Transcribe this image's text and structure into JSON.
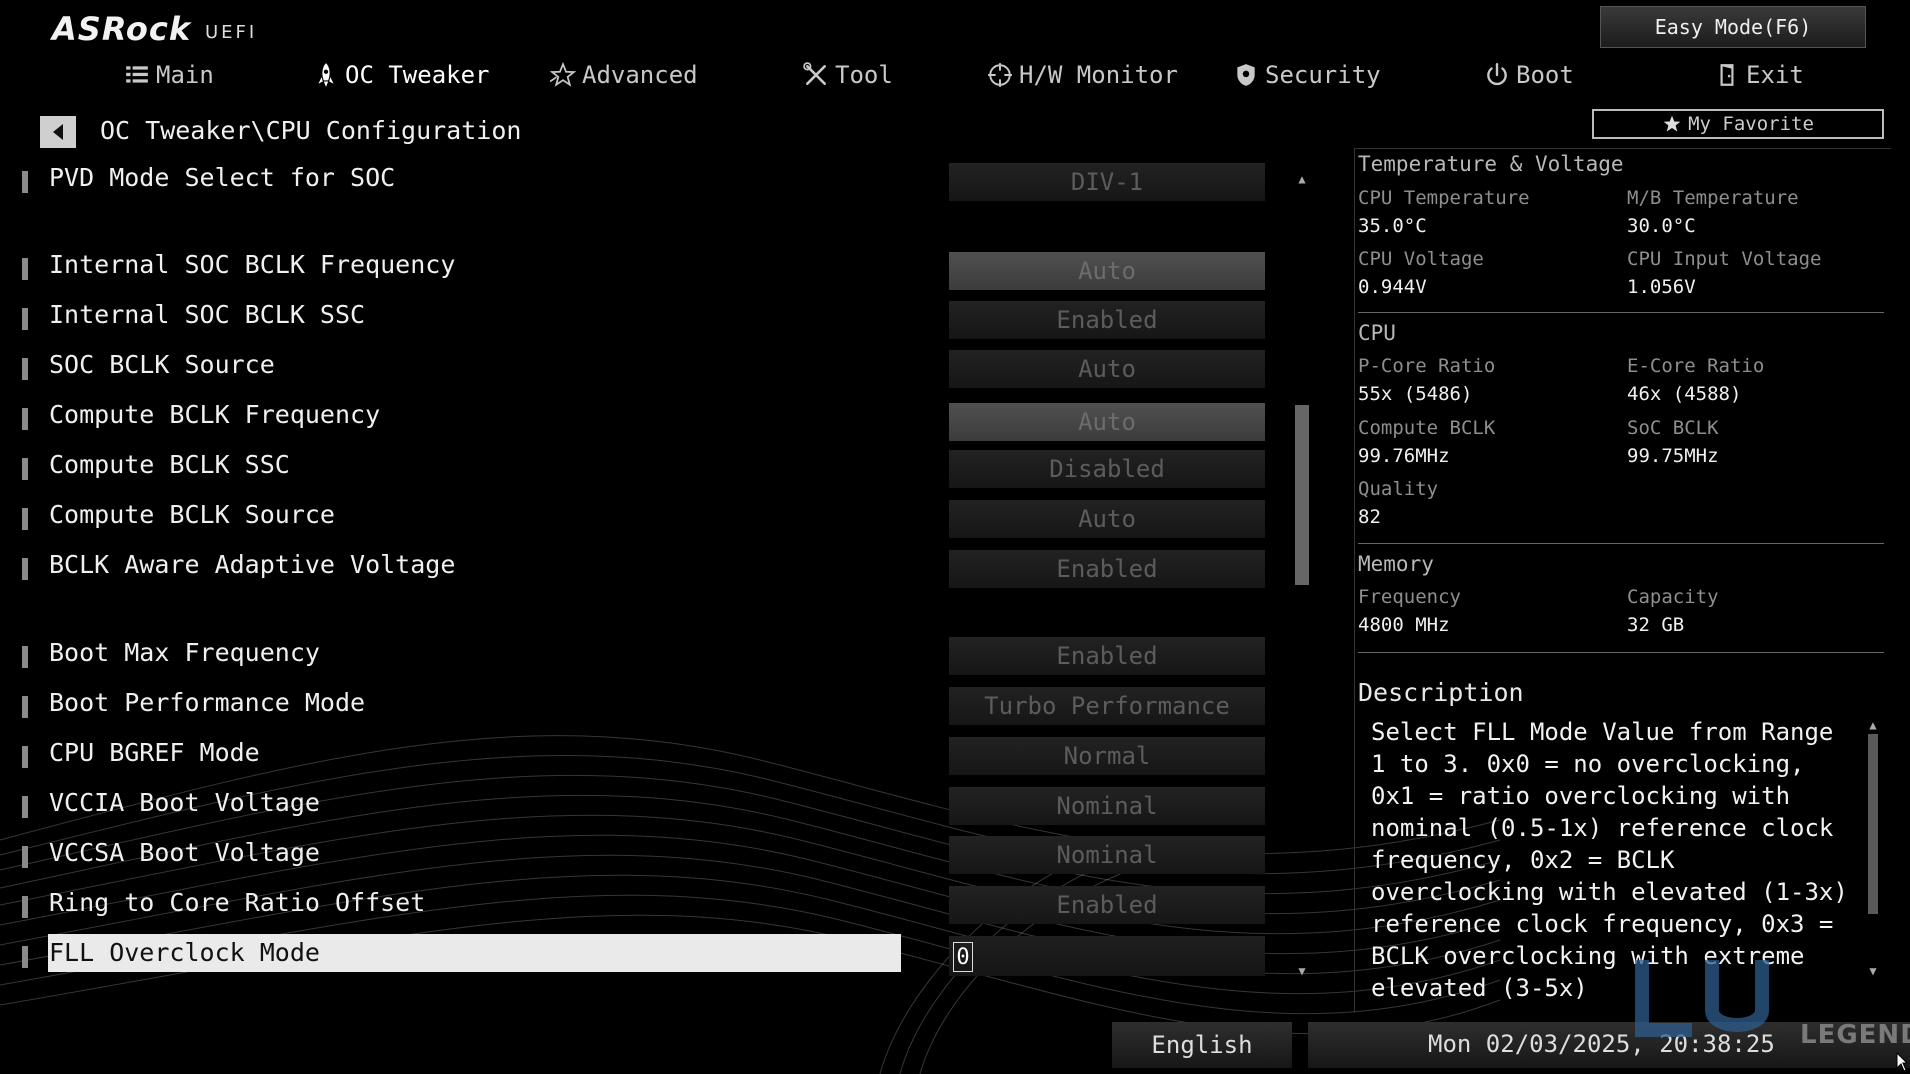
{
  "header": {
    "brand": "ASRock",
    "brand_sub": "UEFI",
    "easy_mode_label": "Easy Mode(F6)",
    "my_favorite_label": "My Favorite",
    "breadcrumb": "OC Tweaker\\CPU Configuration"
  },
  "nav": {
    "main": "Main",
    "oc_tweaker": "OC Tweaker",
    "advanced": "Advanced",
    "tool": "Tool",
    "hw_monitor": "H/W Monitor",
    "security": "Security",
    "boot": "Boot",
    "exit": "Exit"
  },
  "settings": [
    {
      "label": "PVD Mode Select for SOC",
      "value": "DIV-1"
    },
    {
      "label": "Internal SOC BCLK Frequency",
      "value": "Auto"
    },
    {
      "label": "Internal SOC BCLK SSC",
      "value": "Enabled"
    },
    {
      "label": "SOC BCLK Source",
      "value": "Auto"
    },
    {
      "label": "Compute BCLK Frequency",
      "value": "Auto"
    },
    {
      "label": "Compute BCLK SSC",
      "value": "Disabled"
    },
    {
      "label": "Compute BCLK Source",
      "value": "Auto"
    },
    {
      "label": "BCLK Aware Adaptive Voltage",
      "value": "Enabled"
    },
    {
      "label": "Boot Max Frequency",
      "value": "Enabled"
    },
    {
      "label": "Boot Performance Mode",
      "value": "Turbo Performance"
    },
    {
      "label": "CPU BGREF Mode",
      "value": "Normal"
    },
    {
      "label": "VCCIA Boot Voltage",
      "value": "Nominal"
    },
    {
      "label": "VCCSA Boot Voltage",
      "value": "Nominal"
    },
    {
      "label": "Ring to Core Ratio Offset",
      "value": "Enabled"
    },
    {
      "label": "FLL Overclock Mode",
      "value": "0"
    }
  ],
  "info": {
    "temp_voltage": {
      "title": "Temperature & Voltage",
      "cpu_temp_label": "CPU Temperature",
      "cpu_temp": "35.0°C",
      "mb_temp_label": "M/B Temperature",
      "mb_temp": "30.0°C",
      "cpu_voltage_label": "CPU Voltage",
      "cpu_voltage": "0.944V",
      "cpu_input_voltage_label": "CPU Input Voltage",
      "cpu_input_voltage": "1.056V"
    },
    "cpu": {
      "title": "CPU",
      "pcore_label": "P-Core Ratio",
      "pcore": "55x (5486)",
      "ecore_label": "E-Core Ratio",
      "ecore": "46x (4588)",
      "compute_bclk_label": "Compute BCLK",
      "compute_bclk": "99.76MHz",
      "soc_bclk_label": "SoC BCLK",
      "soc_bclk": "99.75MHz",
      "quality_label": "Quality",
      "quality": "82"
    },
    "memory": {
      "title": "Memory",
      "frequency_label": "Frequency",
      "frequency": "4800 MHz",
      "capacity_label": "Capacity",
      "capacity": "32 GB"
    }
  },
  "description": {
    "title": "Description",
    "text": "Select FLL Mode Value from Range 1 to 3. 0x0 = no overclocking, 0x1 = ratio overclocking with nominal (0.5-1x) reference clock frequency, 0x2 = BCLK overclocking with elevated (1-3x) reference clock frequency, 0x3 = BCLK overclocking with extreme elevated (3-5x)"
  },
  "footer": {
    "language": "English",
    "datetime": "Mon 02/03/2025, 20:38:25"
  },
  "watermark": "LEGEND",
  "icons": [
    "list-icon",
    "rocket-icon",
    "star-icon",
    "wrench-icon",
    "crosshair-icon",
    "shield-icon",
    "power-icon",
    "exit-door-icon",
    "back-arrow-icon",
    "favorite-star-icon"
  ]
}
